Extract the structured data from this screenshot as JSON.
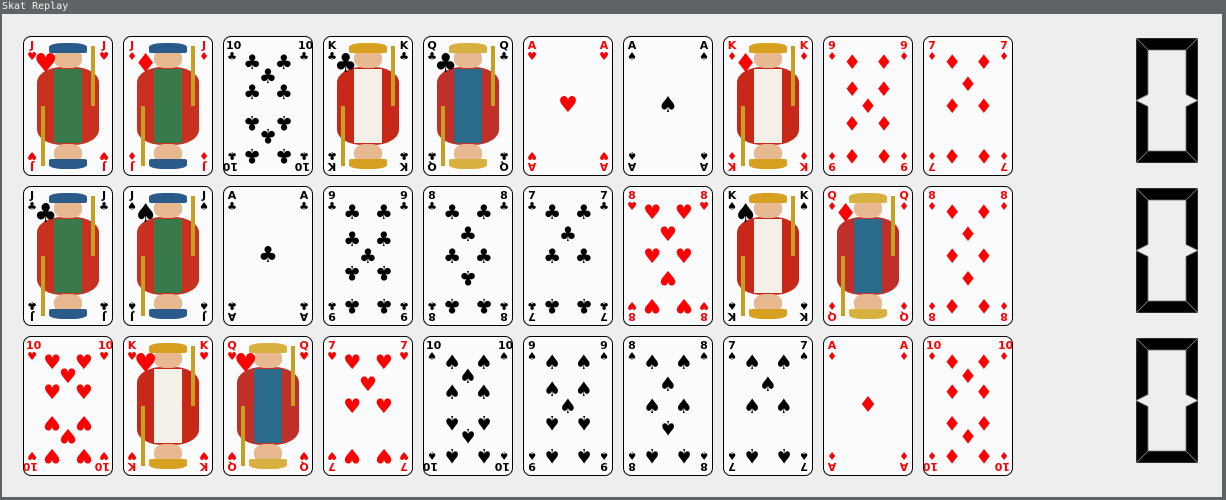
{
  "window": {
    "title": "Skat Replay"
  },
  "colors": {
    "red": "#ff0000",
    "black": "#000000",
    "background": "#eeeeee",
    "titlebar": "#5e6466"
  },
  "suit_symbols": {
    "hearts": "♥",
    "diamonds": "♦",
    "clubs": "♣",
    "spades": "♠"
  },
  "rows": [
    {
      "name": "player-1-hand",
      "score": "0",
      "cards": [
        {
          "rank": "J",
          "suit": "hearts"
        },
        {
          "rank": "J",
          "suit": "diamonds"
        },
        {
          "rank": "10",
          "suit": "clubs"
        },
        {
          "rank": "K",
          "suit": "clubs"
        },
        {
          "rank": "Q",
          "suit": "clubs"
        },
        {
          "rank": "A",
          "suit": "hearts"
        },
        {
          "rank": "A",
          "suit": "spades"
        },
        {
          "rank": "K",
          "suit": "diamonds"
        },
        {
          "rank": "9",
          "suit": "diamonds"
        },
        {
          "rank": "7",
          "suit": "diamonds"
        }
      ]
    },
    {
      "name": "player-2-hand",
      "score": "0",
      "cards": [
        {
          "rank": "J",
          "suit": "clubs"
        },
        {
          "rank": "J",
          "suit": "spades"
        },
        {
          "rank": "A",
          "suit": "clubs"
        },
        {
          "rank": "9",
          "suit": "clubs"
        },
        {
          "rank": "8",
          "suit": "clubs"
        },
        {
          "rank": "7",
          "suit": "clubs"
        },
        {
          "rank": "8",
          "suit": "hearts"
        },
        {
          "rank": "K",
          "suit": "spades"
        },
        {
          "rank": "Q",
          "suit": "diamonds"
        },
        {
          "rank": "8",
          "suit": "diamonds"
        }
      ]
    },
    {
      "name": "player-3-hand",
      "score": "0",
      "cards": [
        {
          "rank": "10",
          "suit": "hearts"
        },
        {
          "rank": "K",
          "suit": "hearts"
        },
        {
          "rank": "Q",
          "suit": "hearts"
        },
        {
          "rank": "7",
          "suit": "hearts"
        },
        {
          "rank": "10",
          "suit": "spades"
        },
        {
          "rank": "9",
          "suit": "spades"
        },
        {
          "rank": "8",
          "suit": "spades"
        },
        {
          "rank": "7",
          "suit": "spades"
        },
        {
          "rank": "A",
          "suit": "diamonds"
        },
        {
          "rank": "10",
          "suit": "diamonds"
        }
      ]
    }
  ]
}
